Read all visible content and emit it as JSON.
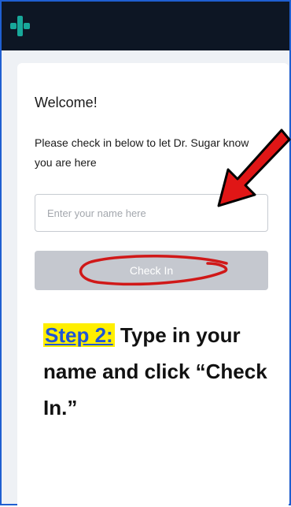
{
  "colors": {
    "topbar": "#0d1624",
    "accent_logo": "#18a89a",
    "frame_border": "#1f5fd1",
    "button_disabled": "#c5c8cf",
    "annotation_red": "#e01616",
    "highlight": "#ffef00",
    "step_label_color": "#1f55d6"
  },
  "header": {
    "logo_icon": "medical-cross-icon"
  },
  "card": {
    "title": "Welcome!",
    "instructions": "Please check in below to let Dr. Sugar know you are here",
    "name_input": {
      "placeholder": "Enter your name here",
      "value": ""
    },
    "checkin_button_label": "Check In"
  },
  "annotation": {
    "step_label": "Step 2:",
    "step_text": "Type in your name and click “Check In.”"
  }
}
